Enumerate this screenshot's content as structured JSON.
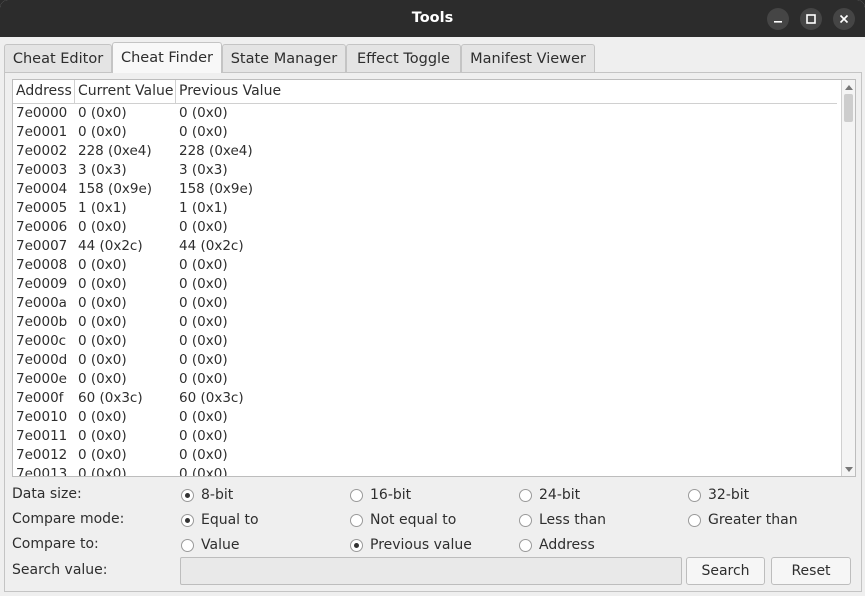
{
  "window": {
    "title": "Tools",
    "controls": [
      "minimize-icon",
      "maximize-icon",
      "close-icon"
    ]
  },
  "tabs": [
    {
      "label": "Cheat Editor",
      "active": false
    },
    {
      "label": "Cheat Finder",
      "active": true
    },
    {
      "label": "State Manager",
      "active": false
    },
    {
      "label": "Effect Toggle",
      "active": false
    },
    {
      "label": "Manifest Viewer",
      "active": false
    }
  ],
  "table": {
    "columns": [
      "Address",
      "Current Value",
      "Previous Value"
    ],
    "rows": [
      [
        "7e0000",
        "0 (0x0)",
        "0 (0x0)"
      ],
      [
        "7e0001",
        "0 (0x0)",
        "0 (0x0)"
      ],
      [
        "7e0002",
        "228 (0xe4)",
        "228 (0xe4)"
      ],
      [
        "7e0003",
        "3 (0x3)",
        "3 (0x3)"
      ],
      [
        "7e0004",
        "158 (0x9e)",
        "158 (0x9e)"
      ],
      [
        "7e0005",
        "1 (0x1)",
        "1 (0x1)"
      ],
      [
        "7e0006",
        "0 (0x0)",
        "0 (0x0)"
      ],
      [
        "7e0007",
        "44 (0x2c)",
        "44 (0x2c)"
      ],
      [
        "7e0008",
        "0 (0x0)",
        "0 (0x0)"
      ],
      [
        "7e0009",
        "0 (0x0)",
        "0 (0x0)"
      ],
      [
        "7e000a",
        "0 (0x0)",
        "0 (0x0)"
      ],
      [
        "7e000b",
        "0 (0x0)",
        "0 (0x0)"
      ],
      [
        "7e000c",
        "0 (0x0)",
        "0 (0x0)"
      ],
      [
        "7e000d",
        "0 (0x0)",
        "0 (0x0)"
      ],
      [
        "7e000e",
        "0 (0x0)",
        "0 (0x0)"
      ],
      [
        "7e000f",
        "60 (0x3c)",
        "60 (0x3c)"
      ],
      [
        "7e0010",
        "0 (0x0)",
        "0 (0x0)"
      ],
      [
        "7e0011",
        "0 (0x0)",
        "0 (0x0)"
      ],
      [
        "7e0012",
        "0 (0x0)",
        "0 (0x0)"
      ],
      [
        "7e0013",
        "0 (0x0)",
        "0 (0x0)"
      ]
    ]
  },
  "options": {
    "data_size": {
      "label": "Data size:",
      "choices": [
        "8-bit",
        "16-bit",
        "24-bit",
        "32-bit"
      ],
      "selected": "8-bit"
    },
    "compare_mode": {
      "label": "Compare mode:",
      "choices": [
        "Equal to",
        "Not equal to",
        "Less than",
        "Greater than"
      ],
      "selected": "Equal to"
    },
    "compare_to": {
      "label": "Compare to:",
      "choices": [
        "Value",
        "Previous value",
        "Address"
      ],
      "selected": "Previous value"
    }
  },
  "search": {
    "label": "Search value:",
    "value": "",
    "placeholder": "",
    "search_button": "Search",
    "reset_button": "Reset"
  }
}
